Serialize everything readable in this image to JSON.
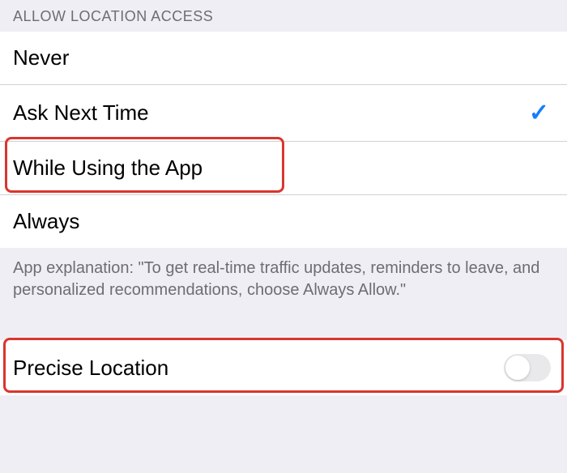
{
  "section": {
    "header": "ALLOW LOCATION ACCESS",
    "options": [
      {
        "label": "Never",
        "selected": false
      },
      {
        "label": "Ask Next Time",
        "selected": true
      },
      {
        "label": "While Using the App",
        "selected": false
      },
      {
        "label": "Always",
        "selected": false
      }
    ],
    "explanation": "App explanation: \"To get real-time traffic updates, reminders to leave, and personalized recommendations, choose Always Allow.\""
  },
  "precise": {
    "label": "Precise Location",
    "enabled": false
  },
  "checkmark_glyph": "✓"
}
